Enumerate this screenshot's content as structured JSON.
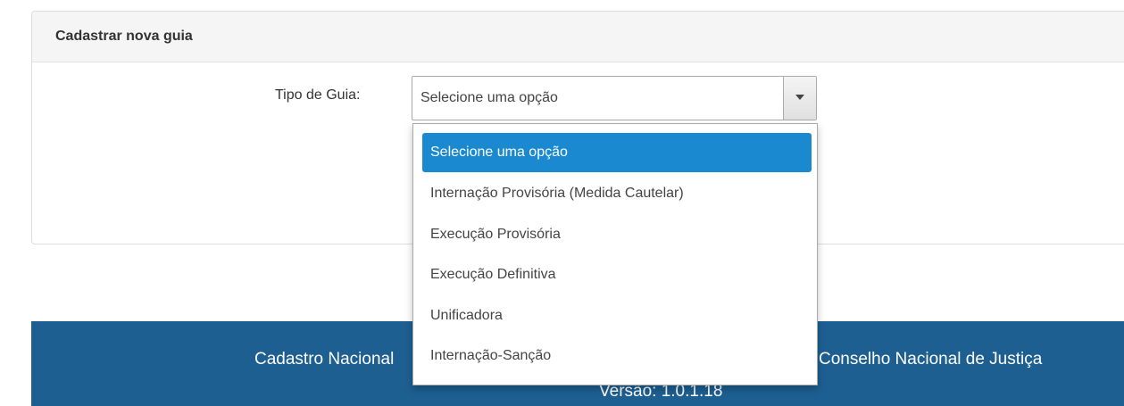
{
  "panel": {
    "title": "Cadastrar nova guia"
  },
  "form": {
    "tipo_label": "Tipo de Guia:",
    "select_value": "Selecione uma opção"
  },
  "dropdown": {
    "options": [
      "Selecione uma opção",
      "Internação Provisória (Medida Cautelar)",
      "Execução Provisória",
      "Execução Definitiva",
      "Unificadora",
      "Internação-Sanção"
    ],
    "selected_index": 0
  },
  "footer": {
    "left_text": "Cadastro Nacional",
    "right_text": "Conselho Nacional de Justiça",
    "version_text": "Versão: 1.0.1.18"
  },
  "colors": {
    "footer_bg": "#1d5f91",
    "highlight": "#1a89d0"
  }
}
